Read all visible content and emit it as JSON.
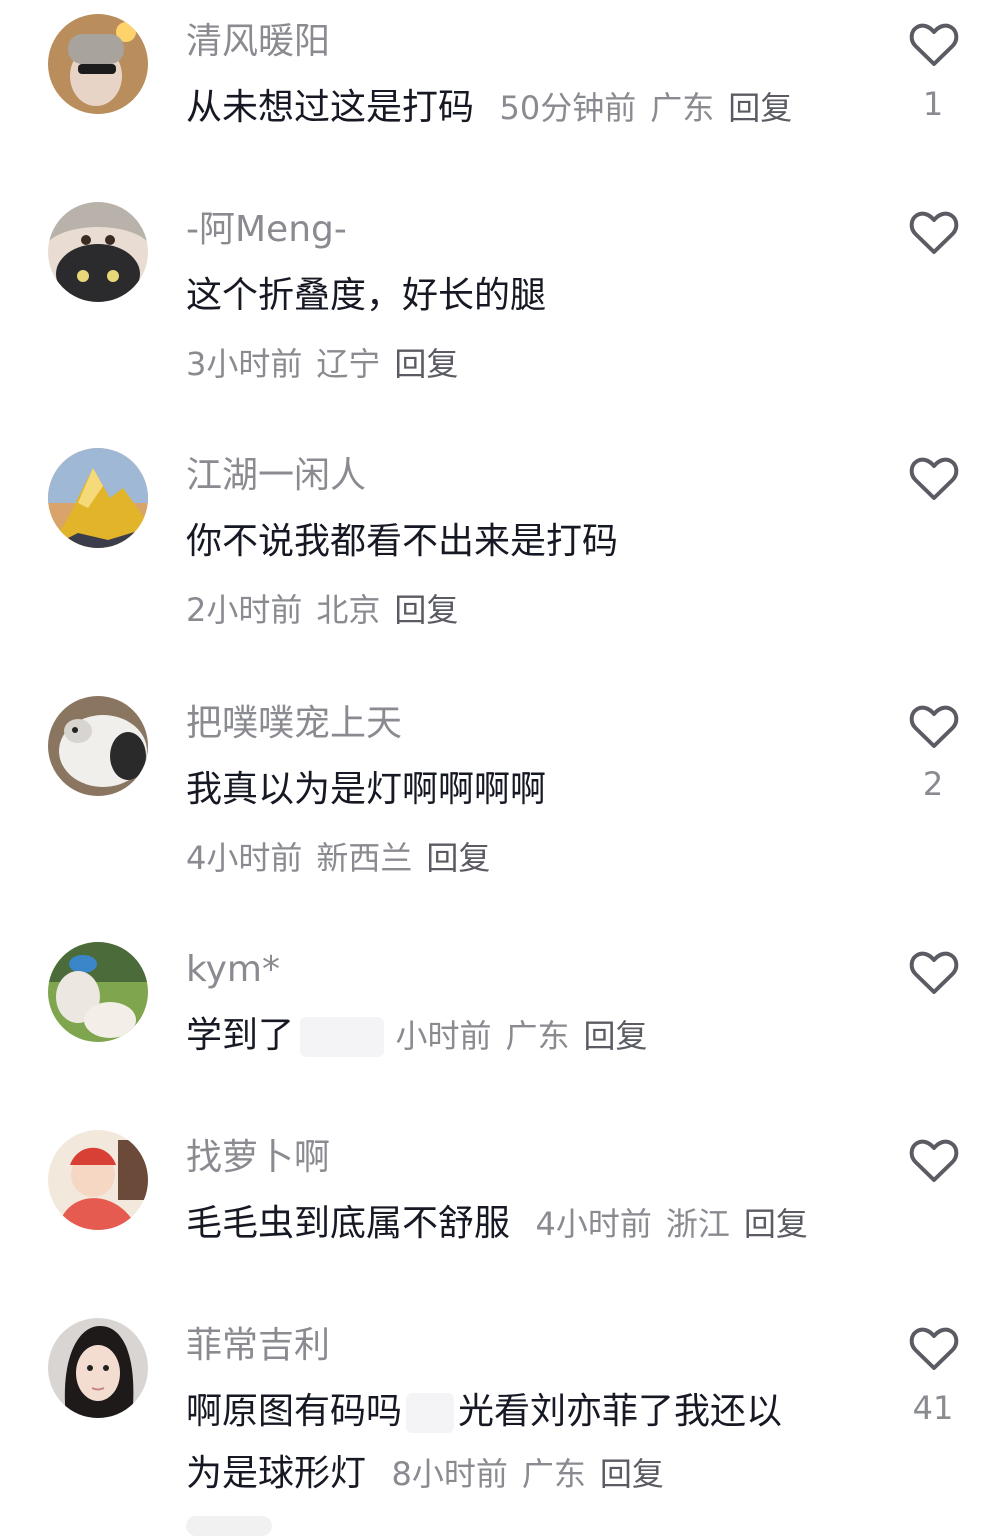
{
  "comments": [
    {
      "username": "清风暖阳",
      "text": "从未想过这是打码",
      "time": "50分钟前",
      "location": "广东",
      "reply": "回复",
      "likes": "1"
    },
    {
      "username": "-阿Meng-",
      "text": "这个折叠度，好长的腿",
      "time": "3小时前",
      "location": "辽宁",
      "reply": "回复",
      "likes": ""
    },
    {
      "username": "江湖一闲人",
      "text": "你不说我都看不出来是打码",
      "time": "2小时前",
      "location": "北京",
      "reply": "回复",
      "likes": ""
    },
    {
      "username": "把噗噗宠上天",
      "text": "我真以为是灯啊啊啊啊",
      "time": "4小时前",
      "location": "新西兰",
      "reply": "回复",
      "likes": "2"
    },
    {
      "username": "kym*",
      "text": "学到了",
      "time": "小时前",
      "location": "广东",
      "reply": "回复",
      "likes": ""
    },
    {
      "username": "找萝卜啊",
      "text": "毛毛虫到底属不舒服",
      "time": "4小时前",
      "location": "浙江",
      "reply": "回复",
      "likes": ""
    },
    {
      "username": "菲常吉利",
      "text": "啊原图有码吗",
      "text2": "光看刘亦菲了我还以",
      "text3": "为是球形灯",
      "time": "8小时前",
      "location": "广东",
      "reply": "回复",
      "likes": "41"
    }
  ],
  "icons": {
    "like": "heart-outline-icon"
  },
  "colors": {
    "name": "#8a8b91",
    "text": "#161823",
    "reply": "#5b5c63",
    "background": "#ffffff"
  }
}
